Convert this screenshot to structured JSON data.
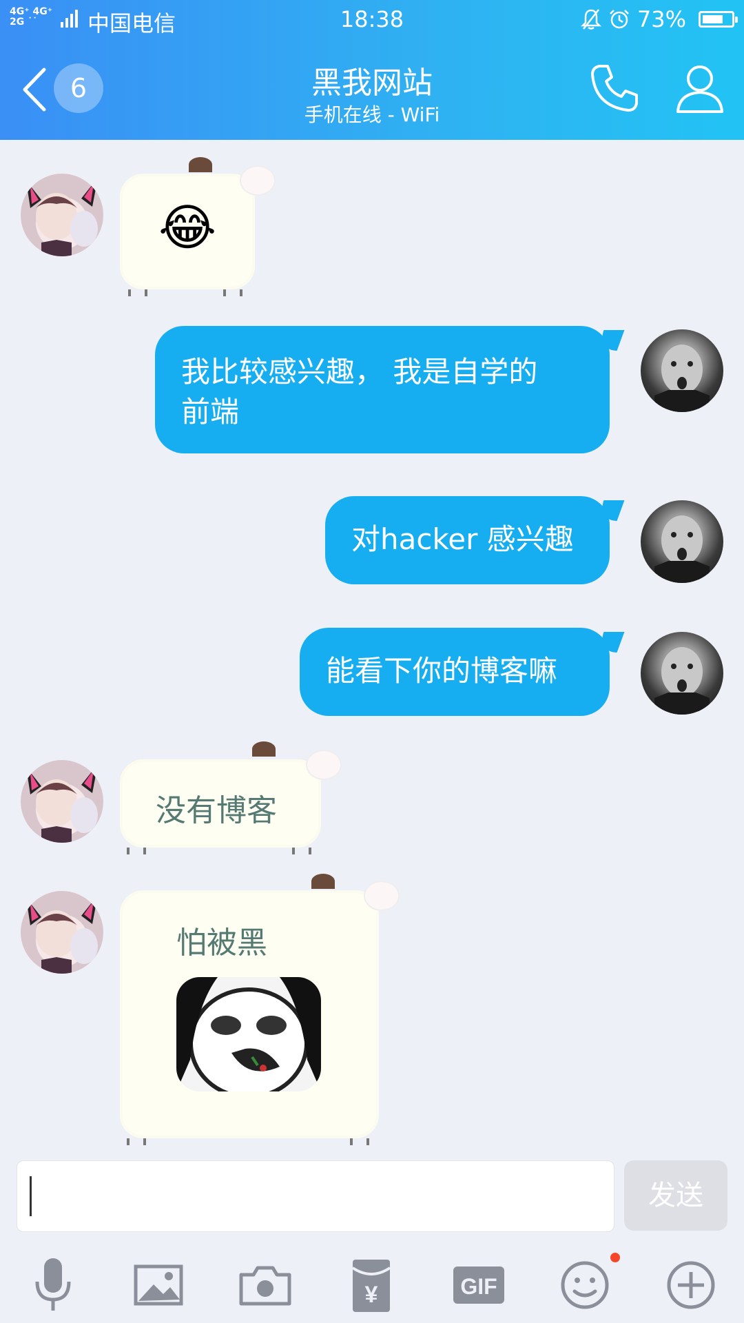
{
  "status_bar": {
    "signal": [
      "4G⁺ 4G⁺",
      "2G ˙˙"
    ],
    "carrier": "中国电信",
    "time": "18:38",
    "battery": "73%",
    "battery_level": 0.73
  },
  "header": {
    "back_badge": "6",
    "title": "黑我网站",
    "subtitle": "手机在线 - WiFi"
  },
  "messages": [
    {
      "side": "left",
      "type": "emoji",
      "emoji": "😂"
    },
    {
      "side": "right",
      "type": "text",
      "text": "我比较感兴趣， 我是自学的 前端"
    },
    {
      "side": "right",
      "type": "text",
      "text": "对hacker 感兴趣"
    },
    {
      "side": "right",
      "type": "text",
      "text": "能看下你的博客嘛"
    },
    {
      "side": "left",
      "type": "text",
      "text": "没有博客"
    },
    {
      "side": "left",
      "type": "text+sticker",
      "text": "怕被黑",
      "sticker": "panda-meme"
    }
  ],
  "input": {
    "placeholder": "",
    "value": ""
  },
  "send_label": "发送",
  "toolbar": {
    "icons": [
      "microphone-icon",
      "image-icon",
      "camera-icon",
      "red-packet-icon",
      "gif-icon",
      "emoji-icon",
      "plus-icon"
    ],
    "gif_label": "GIF",
    "yuan_label": "¥"
  },
  "colors": {
    "header_start": "#3a8ff5",
    "header_end": "#22c3f4",
    "bubble_blue": "#16aef1",
    "background": "#eef0f7",
    "notify_dot": "#f5452a"
  }
}
